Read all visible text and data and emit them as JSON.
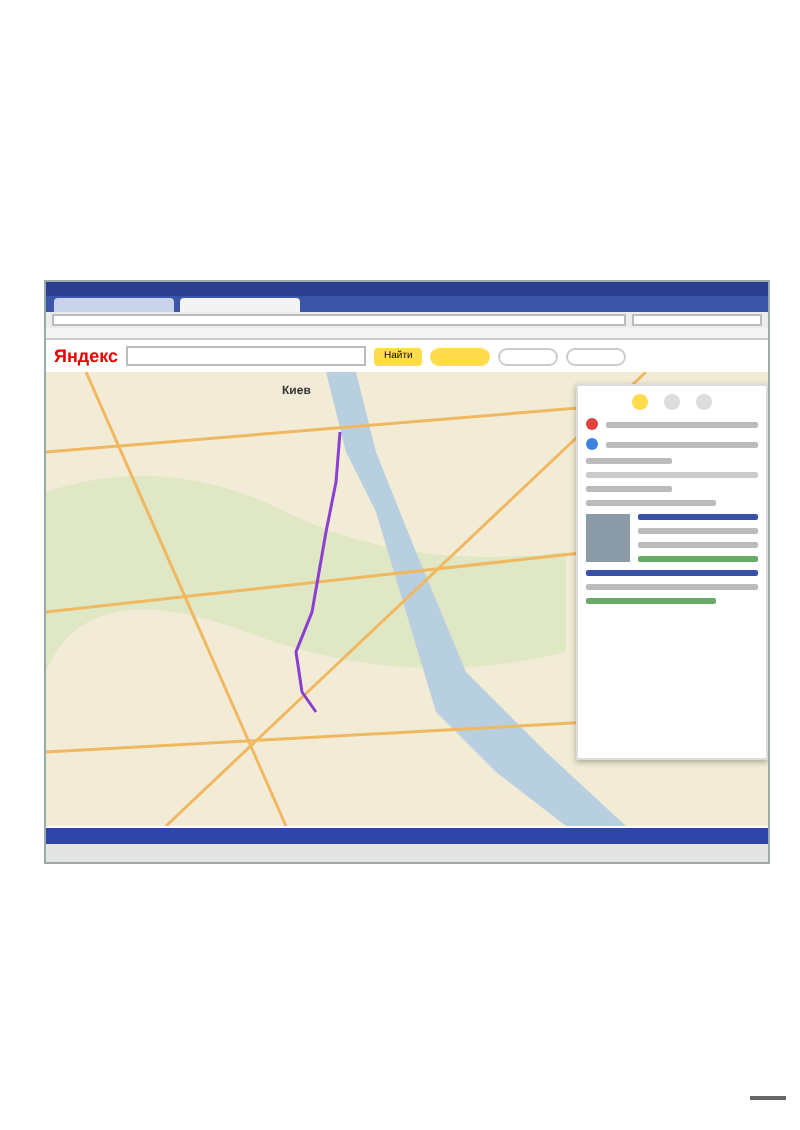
{
  "header": {
    "logo": "Яндекс",
    "search_button": "Найти"
  },
  "map": {
    "city_label": "Киев"
  },
  "route_panel": {
    "modes": [
      {
        "selected": true
      },
      {
        "selected": false
      },
      {
        "selected": false
      }
    ]
  }
}
